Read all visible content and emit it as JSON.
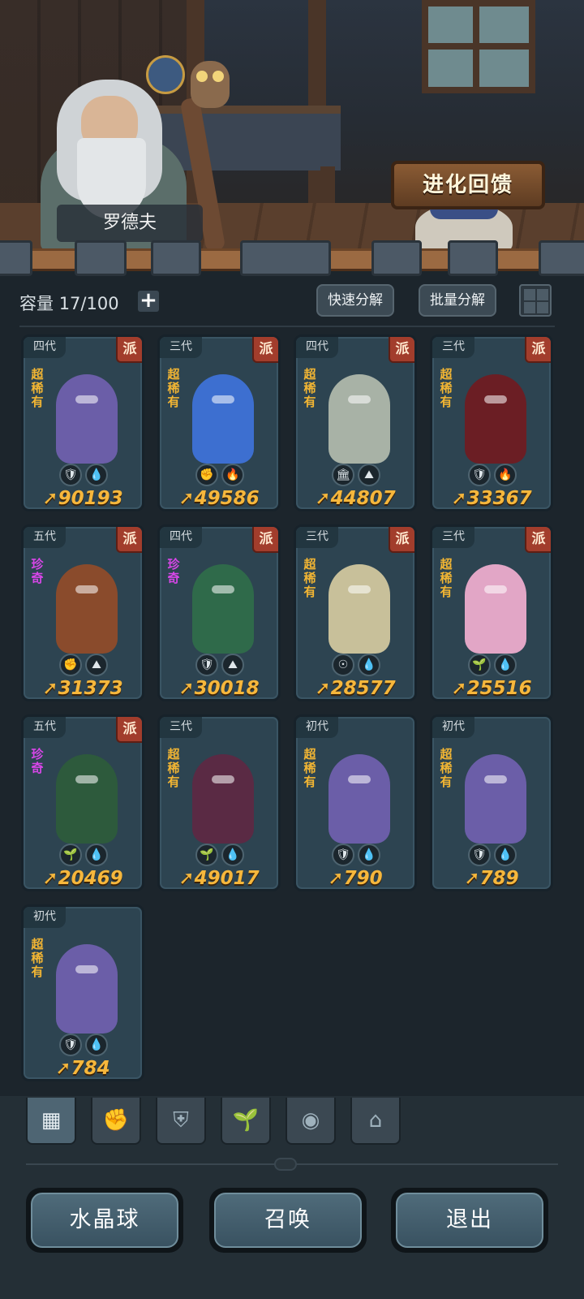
{
  "npc": {
    "name": "罗德夫"
  },
  "header": {
    "evolve_feedback_label": "进化回馈"
  },
  "inventory": {
    "capacity_label": "容量",
    "capacity_value": "17/100",
    "plus_label": "+",
    "quick_decompose_label": "快速分解",
    "batch_decompose_label": "批量分解",
    "grid_view_icon": "grid-icon"
  },
  "cards": [
    {
      "gen": "四代",
      "faction": "派",
      "rarity": "超稀有",
      "rarity_type": "super",
      "power": "90193",
      "badges": [
        "🛡",
        "💧"
      ],
      "badge_icons": [
        "shield-icon",
        "water-icon"
      ],
      "creature_color": "#6b5ea8"
    },
    {
      "gen": "三代",
      "faction": "派",
      "rarity": "超稀有",
      "rarity_type": "super",
      "power": "49586",
      "badges": [
        "✊",
        "🔥"
      ],
      "badge_icons": [
        "fist-icon",
        "fire-icon"
      ],
      "creature_color": "#3d6fd0"
    },
    {
      "gen": "四代",
      "faction": "派",
      "rarity": "超稀有",
      "rarity_type": "super",
      "power": "44807",
      "badges": [
        "🏛",
        "⛰"
      ],
      "badge_icons": [
        "tower-icon",
        "earth-icon"
      ],
      "creature_color": "#a8b2a6"
    },
    {
      "gen": "三代",
      "faction": "派",
      "rarity": "超稀有",
      "rarity_type": "super",
      "power": "33367",
      "badges": [
        "🛡",
        "🔥"
      ],
      "badge_icons": [
        "shield-icon",
        "fire-icon"
      ],
      "creature_color": "#6b1e24"
    },
    {
      "gen": "五代",
      "faction": "派",
      "rarity": "珍奇",
      "rarity_type": "rare",
      "power": "31373",
      "badges": [
        "✊",
        "⛰"
      ],
      "badge_icons": [
        "fist-icon",
        "earth-icon"
      ],
      "creature_color": "#8a4b2c"
    },
    {
      "gen": "四代",
      "faction": "派",
      "rarity": "珍奇",
      "rarity_type": "rare",
      "power": "30018",
      "badges": [
        "🛡",
        "⛰"
      ],
      "badge_icons": [
        "shield-icon",
        "earth-icon"
      ],
      "creature_color": "#2f6a4a"
    },
    {
      "gen": "三代",
      "faction": "派",
      "rarity": "超稀有",
      "rarity_type": "super",
      "power": "28577",
      "badges": [
        "☉",
        "💧"
      ],
      "badge_icons": [
        "spirit-icon",
        "water-icon"
      ],
      "creature_color": "#c8c09a"
    },
    {
      "gen": "三代",
      "faction": "派",
      "rarity": "超稀有",
      "rarity_type": "super",
      "power": "25516",
      "badges": [
        "🌱",
        "💧"
      ],
      "badge_icons": [
        "leaf-icon",
        "water-icon"
      ],
      "creature_color": "#e2a6c6"
    },
    {
      "gen": "五代",
      "faction": "派",
      "rarity": "珍奇",
      "rarity_type": "rare",
      "power": "20469",
      "badges": [
        "🌱",
        "💧"
      ],
      "badge_icons": [
        "leaf-icon",
        "water-icon"
      ],
      "creature_color": "#2d5a3c"
    },
    {
      "gen": "三代",
      "faction": "",
      "rarity": "超稀有",
      "rarity_type": "super",
      "power": "49017",
      "badges": [
        "🌱",
        "💧"
      ],
      "badge_icons": [
        "leaf-icon",
        "water-icon"
      ],
      "creature_color": "#5a2a44"
    },
    {
      "gen": "初代",
      "faction": "",
      "rarity": "超稀有",
      "rarity_type": "super",
      "power": "790",
      "badges": [
        "🛡",
        "💧"
      ],
      "badge_icons": [
        "shield-icon",
        "water-icon"
      ],
      "creature_color": "#6b5ea8"
    },
    {
      "gen": "初代",
      "faction": "",
      "rarity": "超稀有",
      "rarity_type": "super",
      "power": "789",
      "badges": [
        "🛡",
        "💧"
      ],
      "badge_icons": [
        "shield-icon",
        "water-icon"
      ],
      "creature_color": "#6b5ea8"
    },
    {
      "gen": "初代",
      "faction": "",
      "rarity": "超稀有",
      "rarity_type": "super",
      "power": "784",
      "badges": [
        "🛡",
        "💧"
      ],
      "badge_icons": [
        "shield-icon",
        "water-icon"
      ],
      "creature_color": "#6b5ea8"
    }
  ],
  "filter_tabs": [
    {
      "icon": "all-icon",
      "glyph": "▦",
      "active": true
    },
    {
      "icon": "fist-icon",
      "glyph": "✊",
      "active": false
    },
    {
      "icon": "shield-icon",
      "glyph": "⛨",
      "active": false
    },
    {
      "icon": "leaf-icon",
      "glyph": "🌱",
      "active": false
    },
    {
      "icon": "spirit-icon",
      "glyph": "◉",
      "active": false
    },
    {
      "icon": "tower-icon",
      "glyph": "⌂",
      "active": false
    }
  ],
  "footer": {
    "crystal_ball_label": "水晶球",
    "summon_label": "召唤",
    "exit_label": "退出"
  },
  "colors": {
    "power": "#f6b73c",
    "super_rare": "#f3b633",
    "rare": "#d746e8",
    "faction": "#a23d2c"
  }
}
